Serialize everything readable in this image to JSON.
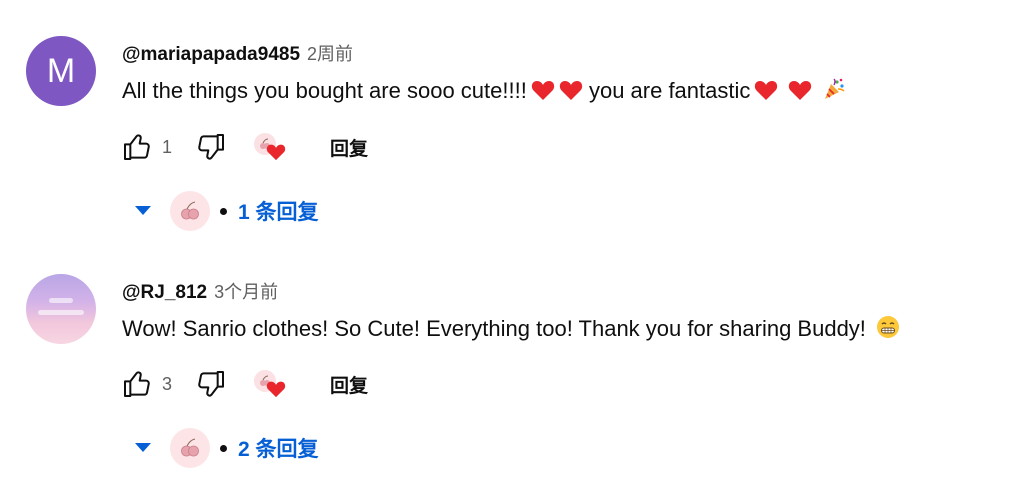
{
  "comments": [
    {
      "avatar_letter": "M",
      "avatar_color": "#7e57c2",
      "author": "@mariapapada9485",
      "time": "2周前",
      "text": "All the things you bought are sooo cute!!!!",
      "text_mid": "you are fantastic",
      "likes": "1",
      "reply_label": "回复",
      "replies_label": "1 条回复"
    },
    {
      "avatar_icon": "sky-avatar",
      "author": "@RJ_812",
      "time": "3个月前",
      "text": "Wow! Sanrio clothes! So Cute! Everything too! Thank you for sharing Buddy!",
      "likes": "3",
      "reply_label": "回复",
      "replies_label": "2 条回复"
    }
  ],
  "colors": {
    "link": "#065fd4",
    "heart": "#e8262b",
    "muted": "#606060"
  }
}
